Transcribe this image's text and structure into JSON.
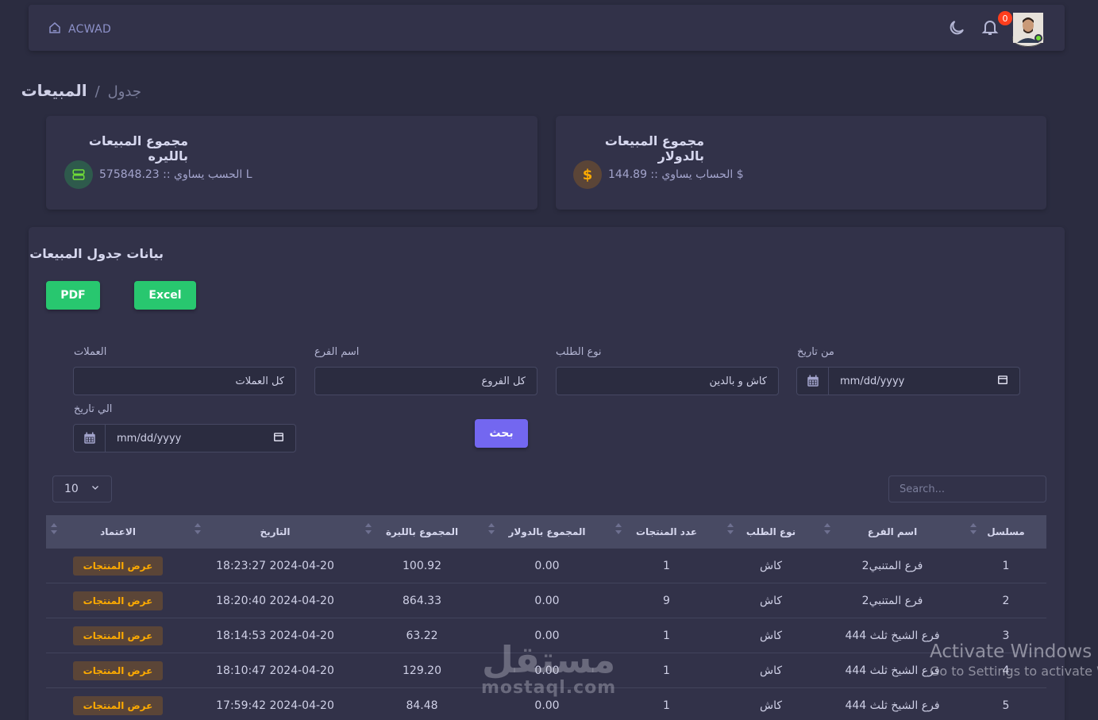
{
  "navbar": {
    "brand": "ACWAD",
    "notification_count": "0"
  },
  "breadcrumb": {
    "current": "المبيعات",
    "separator": "/",
    "parent": "جدول"
  },
  "cards": {
    "lira": {
      "title": "مجموع المبيعات بالليره",
      "value": "575848.23 :: الحسب يساوي L"
    },
    "dollar": {
      "title": "مجموع المبيعات بالدولار",
      "value": "144.89 :: الحساب يساوي $",
      "icon_glyph": "$"
    }
  },
  "panel": {
    "title": "بيانات جدول المبيعات",
    "pdf_label": "PDF",
    "excel_label": "Excel"
  },
  "filters": {
    "from_date": {
      "label": "من تاريخ",
      "value": "mm/dd/yyyy"
    },
    "order_type": {
      "label": "نوع الطلب",
      "value": "كاش و بالدين"
    },
    "branch": {
      "label": "اسم الفرع",
      "value": "كل الفروع"
    },
    "currency": {
      "label": "العملات",
      "value": "كل العملات"
    },
    "to_date": {
      "label": "الي تاريخ",
      "value": "mm/dd/yyyy"
    },
    "search_button": "بحث"
  },
  "table_controls": {
    "page_length": "10",
    "search_placeholder": "Search..."
  },
  "table": {
    "headers": [
      "مسلسل",
      "اسم الفرع",
      "نوع الطلب",
      "عدد المنتجات",
      "المجموع بالدولار",
      "المجموع بالليرة",
      "التاريخ",
      "الاعتماد"
    ],
    "action_label": "عرض المنتجات",
    "rows": [
      {
        "serial": "1",
        "branch": "فرع المتنبي2",
        "type": "كاش",
        "count": "1",
        "usd": "0.00",
        "lira": "100.92",
        "date": "2024-04-20 18:23:27"
      },
      {
        "serial": "2",
        "branch": "فرع المتنبي2",
        "type": "كاش",
        "count": "9",
        "usd": "0.00",
        "lira": "864.33",
        "date": "2024-04-20 18:20:40"
      },
      {
        "serial": "3",
        "branch": "فرع الشيخ ثلث 444",
        "type": "كاش",
        "count": "1",
        "usd": "0.00",
        "lira": "63.22",
        "date": "2024-04-20 18:14:53"
      },
      {
        "serial": "4",
        "branch": "فرع الشيخ ثلث 444",
        "type": "كاش",
        "count": "1",
        "usd": "0.00",
        "lira": "129.20",
        "date": "2024-04-20 18:10:47"
      },
      {
        "serial": "5",
        "branch": "فرع الشيخ ثلث 444",
        "type": "كاش",
        "count": "1",
        "usd": "0.00",
        "lira": "84.48",
        "date": "2024-04-20 17:59:42"
      }
    ]
  },
  "overlays": {
    "watermark_ar": "مستقل",
    "watermark_en": "mostaql.com",
    "activate_title": "Activate Windows",
    "activate_sub": "Go to Settings to activate W"
  },
  "colors": {
    "background": "#2b2c40",
    "surface": "#323249",
    "primary": "#7367f0",
    "success": "#28c76f",
    "warning": "#ffab00",
    "danger": "#ff3e1d"
  }
}
